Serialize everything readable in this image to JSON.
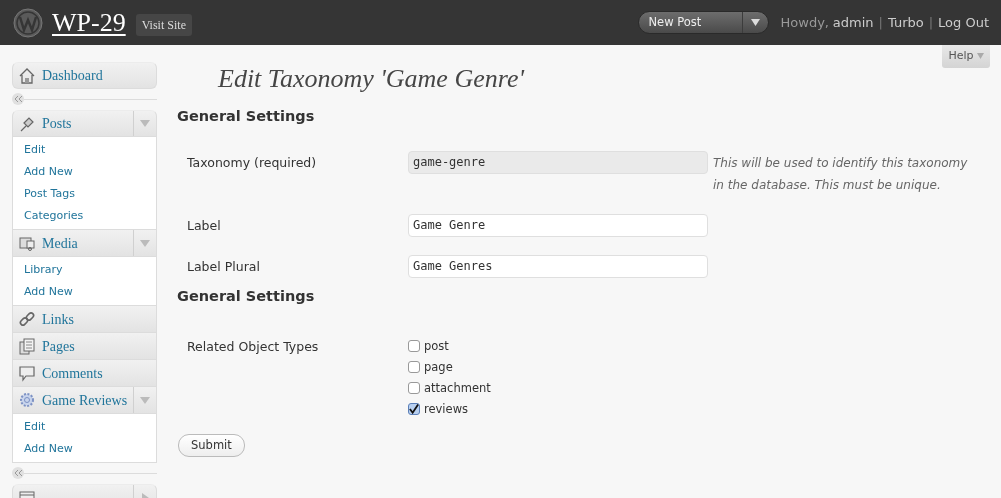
{
  "header": {
    "site_title": "WP-29",
    "visit_site": "Visit Site",
    "new_post": "New Post",
    "howdy": "Howdy,",
    "user": "admin",
    "links": [
      {
        "separator": "|",
        "label": "Turbo"
      },
      {
        "separator": "|",
        "label": "Log Out"
      }
    ]
  },
  "help": "Help",
  "sidebar": {
    "groups": [
      [
        {
          "label": "Dashboard"
        }
      ],
      [
        {
          "label": "Posts",
          "expanded": true,
          "submenu": [
            "Edit",
            "Add New",
            "Post Tags",
            "Categories"
          ]
        },
        {
          "label": "Media",
          "expanded": true,
          "submenu": [
            "Library",
            "Add New"
          ]
        },
        {
          "label": "Links"
        },
        {
          "label": "Pages"
        },
        {
          "label": "Comments"
        },
        {
          "label": "Game Reviews",
          "expanded": true,
          "submenu": [
            "Edit",
            "Add New"
          ]
        }
      ],
      [
        {
          "expanded": false
        }
      ]
    ]
  },
  "page_title": "Edit Taxonomy 'Game Genre'",
  "sections": [
    {
      "heading": "General Settings",
      "fields": [
        {
          "kind": "text",
          "label": "Taxonomy (required)",
          "value": "game-genre",
          "readonly": true,
          "description": "This will be used to identify this taxonomy in the database. This must be unique."
        },
        {
          "kind": "text",
          "label": "Label",
          "value": "Game Genre",
          "readonly": false
        },
        {
          "kind": "text",
          "label": "Label Plural",
          "value": "Game Genres",
          "readonly": false
        }
      ]
    },
    {
      "heading": "General Settings",
      "fields": [
        {
          "kind": "checkboxes",
          "label": "Related Object Types",
          "options": [
            {
              "label": "post",
              "checked": false
            },
            {
              "label": "page",
              "checked": false
            },
            {
              "label": "attachment",
              "checked": false
            },
            {
              "label": "reviews",
              "checked": true
            }
          ]
        }
      ]
    }
  ],
  "submit": "Submit"
}
